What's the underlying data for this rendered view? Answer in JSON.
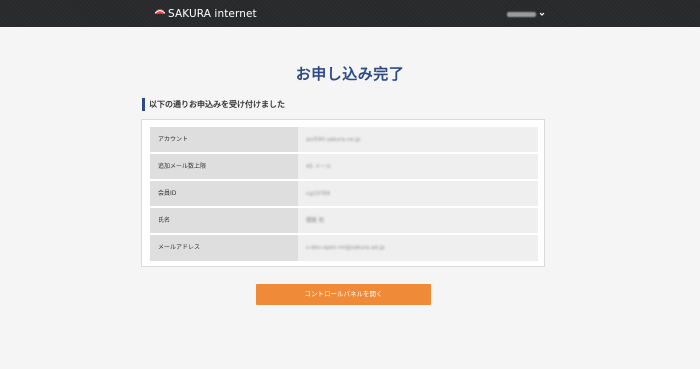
{
  "header": {
    "brand": "SAKURA internet",
    "account_name": "sakurainternet"
  },
  "page": {
    "title": "お申し込み完了",
    "subtitle": "以下の通りお申込みを受け付けました"
  },
  "details": [
    {
      "label": "アカウント",
      "value": "ani590.sakura.ne.jp"
    },
    {
      "label": "追加メール数上限",
      "value": "45 メール"
    },
    {
      "label": "会員ID",
      "value": "cg23789"
    },
    {
      "label": "氏名",
      "value": "櫻散 和"
    },
    {
      "label": "メールアドレス",
      "value": "s-dev-open-ml@sakura.ad.jp"
    }
  ],
  "actions": {
    "open_control_panel": "コントロールパネルを開く"
  },
  "colors": {
    "header_bg": "#27292b",
    "title": "#2d4a88",
    "accent_button": "#ee8a38",
    "logo_red": "#d8434a"
  },
  "icons": {
    "logo": "sakura-logo-icon",
    "menu": "chevron-down-icon"
  }
}
